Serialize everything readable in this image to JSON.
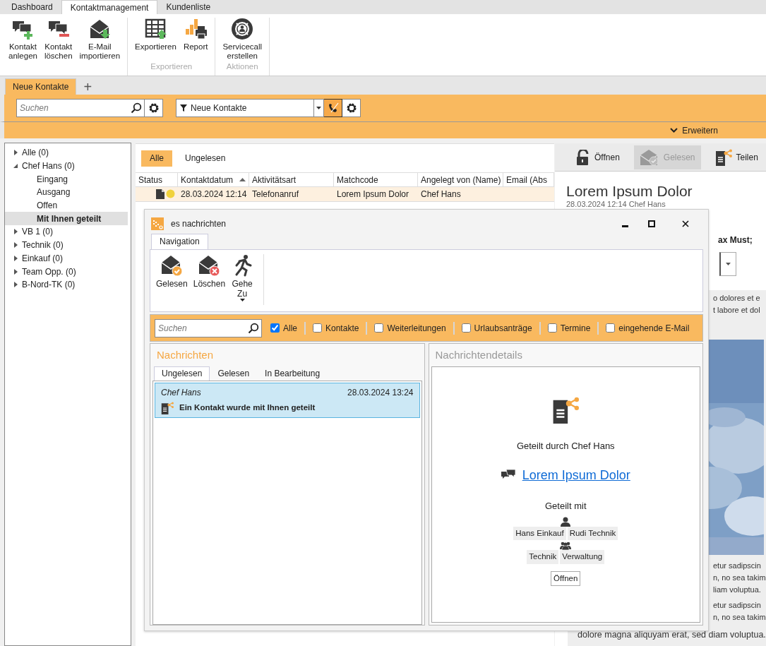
{
  "app_tabs": [
    {
      "label": "Dashboard",
      "selected": false
    },
    {
      "label": "Kontaktmanagement",
      "selected": true
    },
    {
      "label": "Kundenliste",
      "selected": false
    }
  ],
  "ribbon": [
    {
      "items": [
        "Kontakt anlegen",
        "Kontakt löschen",
        "E-Mail importieren"
      ]
    },
    {
      "label": "Exportieren",
      "items": [
        "Exportieren",
        "Report"
      ]
    },
    {
      "label": "Aktionen",
      "items": [
        "Servicecall erstellen"
      ]
    }
  ],
  "view_tabs": [
    {
      "label": "Neue Kontakte",
      "selected": true
    }
  ],
  "add_tab": "+",
  "toolbar": {
    "search_placeholder": "Suchen",
    "filter_value": "Neue Kontakte",
    "toggle_pressed": true,
    "expander": "Erweitern"
  },
  "tree": [
    {
      "label": "Alle (0)",
      "expanded": false,
      "selected": false
    },
    {
      "label": "Chef Hans (0)",
      "expanded": true,
      "selected": false,
      "children": [
        {
          "label": "Eingang",
          "selected": false
        },
        {
          "label": "Ausgang",
          "selected": false
        },
        {
          "label": "Offen",
          "selected": false
        },
        {
          "label": "Mit Ihnen geteilt",
          "selected": true
        }
      ]
    },
    {
      "label": "VB 1 (0)",
      "expanded": false,
      "selected": false
    },
    {
      "label": "Technik (0)",
      "expanded": false,
      "selected": false
    },
    {
      "label": "Einkauf (0)",
      "expanded": false,
      "selected": false
    },
    {
      "label": "Team Opp. (0)",
      "expanded": false,
      "selected": false
    },
    {
      "label": "B-Nord-TK (0)",
      "expanded": false,
      "selected": false
    }
  ],
  "list_filters": [
    {
      "label": "Alle",
      "selected": true
    },
    {
      "label": "Ungelesen",
      "selected": false
    }
  ],
  "table": {
    "columns": [
      {
        "label": "Status",
        "sorted": false
      },
      {
        "label": "Kontaktdatum",
        "sorted": true
      },
      {
        "label": "Aktivitätsart",
        "sorted": false
      },
      {
        "label": "Matchcode",
        "sorted": false
      },
      {
        "label": "Angelegt von (Name)",
        "sorted": false
      },
      {
        "label": "Email (Abs",
        "sorted": false
      }
    ],
    "rows": [
      {
        "selected": true,
        "cells": [
          "",
          "28.03.2024 12:14",
          "Telefonanruf",
          "Lorem Ipsum Dolor",
          "Chef Hans"
        ]
      }
    ]
  },
  "detail": {
    "actions": [
      {
        "label": "Öffnen",
        "disabled": false
      },
      {
        "label": "Gelesen",
        "disabled": true
      },
      {
        "label": "Teilen",
        "disabled": false
      }
    ],
    "title": "Lorem Ipsum Dolor",
    "meta": "28.03.2024 12:14 Chef Hans",
    "field_label": "ax Must;",
    "paragraphs": [
      [
        "o dolores et e",
        "t labore et dol"
      ],
      [
        "etur sadipscin",
        "n, no sea takim",
        "liam voluptua."
      ],
      [
        "etur sadipscin",
        "n, no sea takim"
      ]
    ],
    "last_line": "dolore magna aliquyam erat, sed diam voluptua."
  },
  "dialog": {
    "title": "es nachrichten",
    "tabs": [
      {
        "label": "Navigation",
        "selected": true
      }
    ],
    "actions": [
      {
        "label": "Gelesen",
        "kind": "button"
      },
      {
        "label": "Löschen",
        "kind": "button"
      },
      {
        "label": "Gehe Zu",
        "kind": "dropdown"
      }
    ],
    "search_placeholder": "Suchen",
    "filters": [
      {
        "label": "Alle",
        "checked": true
      },
      {
        "label": "Kontakte",
        "checked": false
      },
      {
        "label": "Weiterleitungen",
        "checked": false
      },
      {
        "label": "Urlaubsanträge",
        "checked": false
      },
      {
        "label": "Termine",
        "checked": false
      },
      {
        "label": "eingehende E-Mail",
        "checked": false
      }
    ],
    "messages": {
      "title": "Nachrichten",
      "tabs": [
        {
          "label": "Ungelesen",
          "selected": true
        },
        {
          "label": "Gelesen",
          "selected": false
        },
        {
          "label": "In Bearbeitung",
          "selected": false
        }
      ],
      "items": [
        {
          "sender": "Chef Hans",
          "time": "28.03.2024 13:24",
          "subject": "Ein Kontakt wurde mit Ihnen geteilt",
          "selected": true
        }
      ]
    },
    "details": {
      "title": "Nachrichtendetails",
      "shared_by": "Geteilt durch Chef Hans",
      "link": "Lorem Ipsum Dolor",
      "shared_with": "Geteilt mit",
      "users": [
        "Hans Einkauf",
        "Rudi Technik"
      ],
      "groups": [
        "Technik",
        "Verwaltung"
      ],
      "button": "Öffnen"
    }
  }
}
